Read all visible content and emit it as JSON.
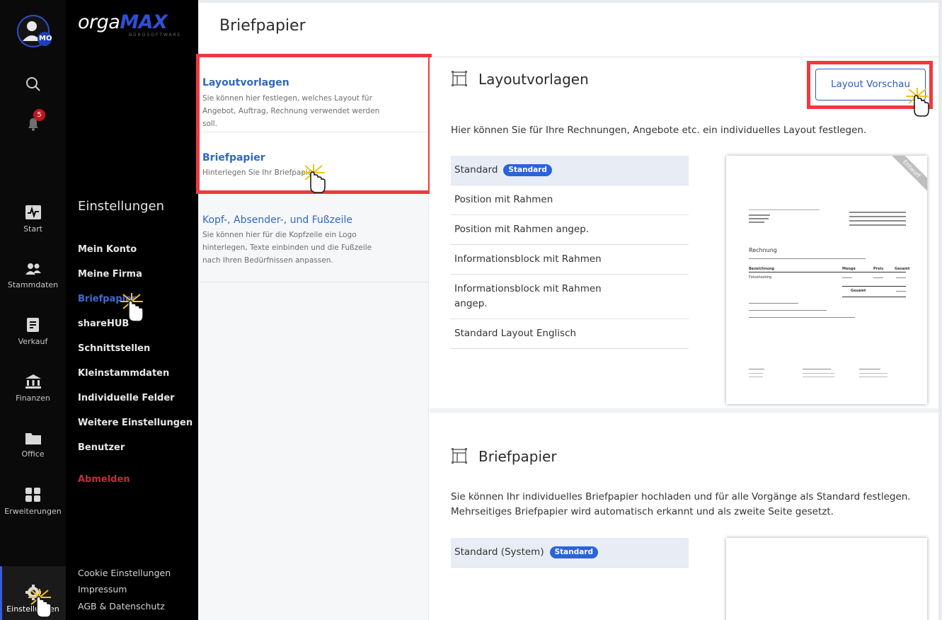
{
  "rail": {
    "avatar_initials": "MO",
    "notification_count": "5",
    "items": [
      {
        "label": "Start",
        "icon": "pulse-icon"
      },
      {
        "label": "Stammdaten",
        "icon": "people-icon"
      },
      {
        "label": "Verkauf",
        "icon": "document-icon"
      },
      {
        "label": "Finanzen",
        "icon": "bank-icon"
      },
      {
        "label": "Office",
        "icon": "folder-icon"
      },
      {
        "label": "Erweiterungen",
        "icon": "apps-icon"
      },
      {
        "label": "Einstellungen",
        "icon": "gear-icon"
      }
    ]
  },
  "brand": {
    "logo_prefix": "orga",
    "logo_bold": "MAX",
    "logo_sub": "BÜROSOFTWARE"
  },
  "menu": {
    "title": "Einstellungen",
    "items": [
      "Mein Konto",
      "Meine Firma",
      "Briefpapier",
      "shareHUB",
      "Schnittstellen",
      "Kleinstammdaten",
      "Individuelle Felder",
      "Weitere Einstellungen",
      "Benutzer"
    ],
    "logout": "Abmelden",
    "footer": [
      "Cookie Einstellungen",
      "Impressum",
      "AGB & Datenschutz"
    ]
  },
  "page": {
    "title": "Briefpapier"
  },
  "subnav": [
    {
      "title": "Layoutvorlagen",
      "desc": "Sie können hier festlegen, welches Layout für Angebot, Auftrag, Rechnung verwendet werden soll."
    },
    {
      "title": "Briefpapier",
      "desc": "Hinterlegen Sie Ihr Briefpapier"
    },
    {
      "title": "Kopf-, Absender-, und Fußzeile",
      "desc": "Sie können hier für die Kopfzeile ein Logo hinterlegen, Texte einbinden und die Fußzeile nach Ihren Bedürfnissen anpassen."
    }
  ],
  "layouts": {
    "title": "Layoutvorlagen",
    "preview_button": "Layout Vorschau",
    "text": "Hier können Sie für Ihre Rechnungen, Angebote etc. ein individuelles Layout festlegen.",
    "rows": [
      "Standard",
      "Position mit Rahmen",
      "Position mit Rahmen angep.",
      "Informationsblock mit Rahmen",
      "Informationsblock mit Rahmen angep.",
      "Standard Layout Englisch"
    ],
    "badge": "Standard",
    "draft_ribbon": "Entwurf"
  },
  "preview_doc": {
    "heading": "Rechnung",
    "col_labels": [
      "Bezeichnung",
      "Menge",
      "Preis",
      "Gesamt"
    ],
    "item": "Fotoshooting",
    "sum_label": "Gesamt"
  },
  "letterhead": {
    "title": "Briefpapier",
    "text": "Sie können Ihr individuelles Briefpapier hochladen und für alle Vorgänge als Standard festlegen. Mehrseitiges Briefpapier wird automatisch erkannt und als zweite Seite gesetzt.",
    "row": "Standard (System)",
    "badge": "Standard"
  },
  "colors": {
    "accent": "#2b63d9",
    "highlight": "#ee3a3f",
    "logout": "#c92a3a"
  }
}
